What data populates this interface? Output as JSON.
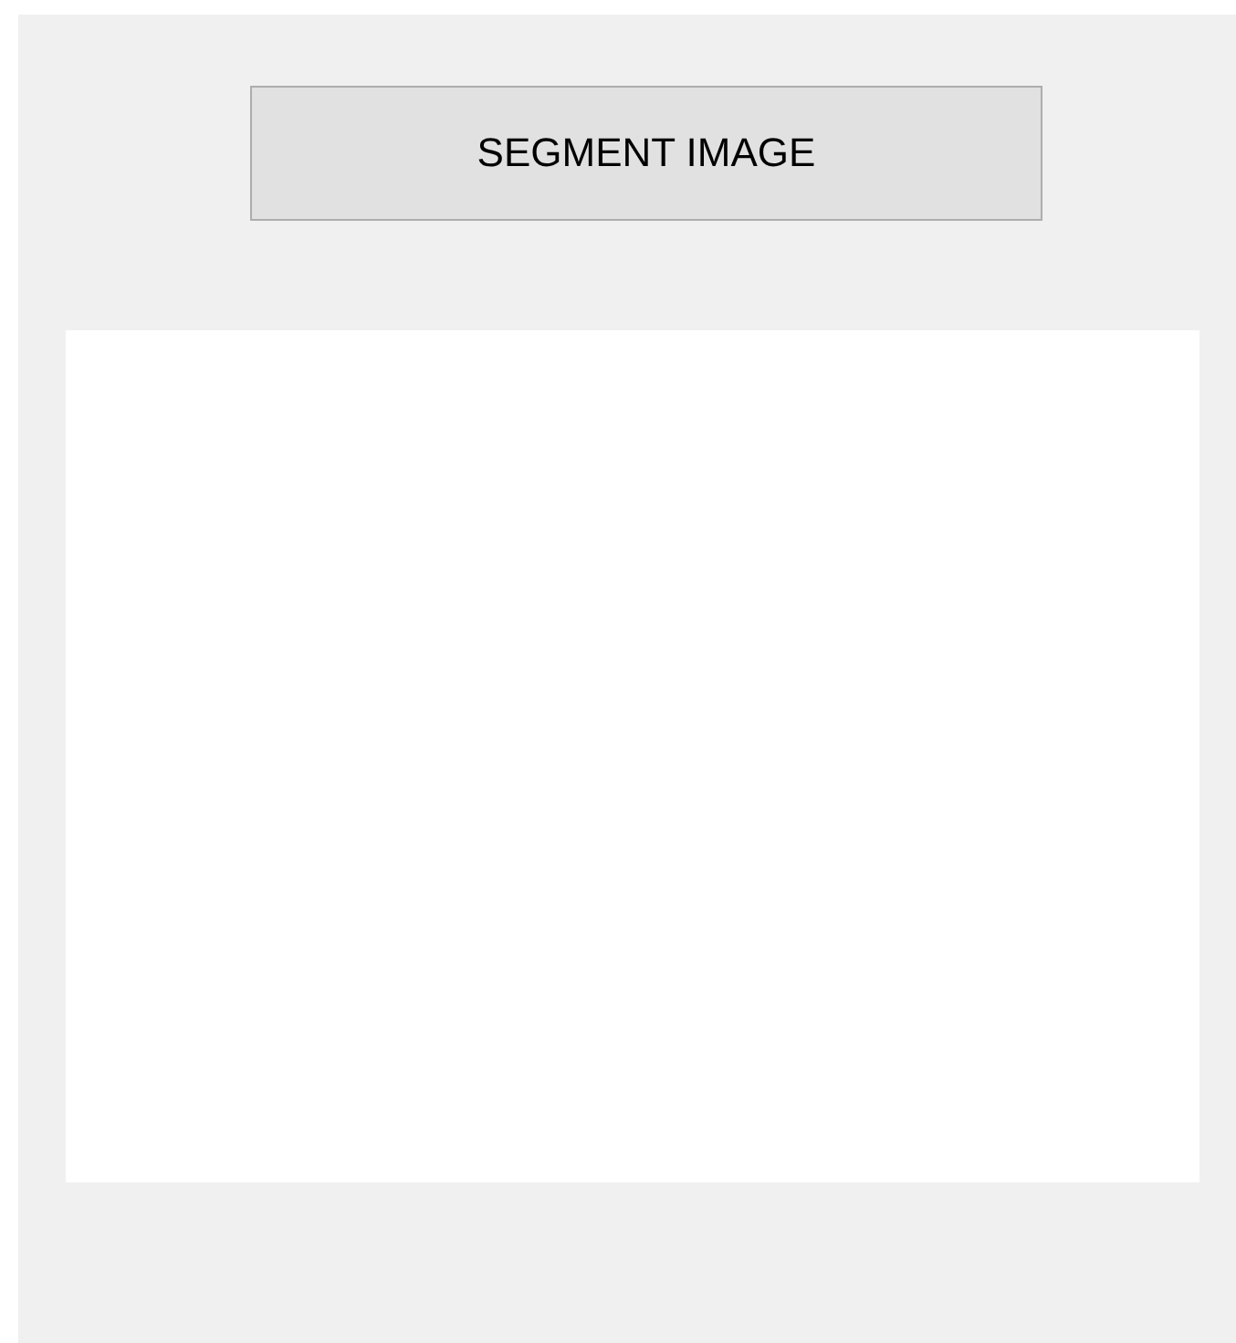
{
  "button": {
    "label": "SEGMENT IMAGE"
  }
}
